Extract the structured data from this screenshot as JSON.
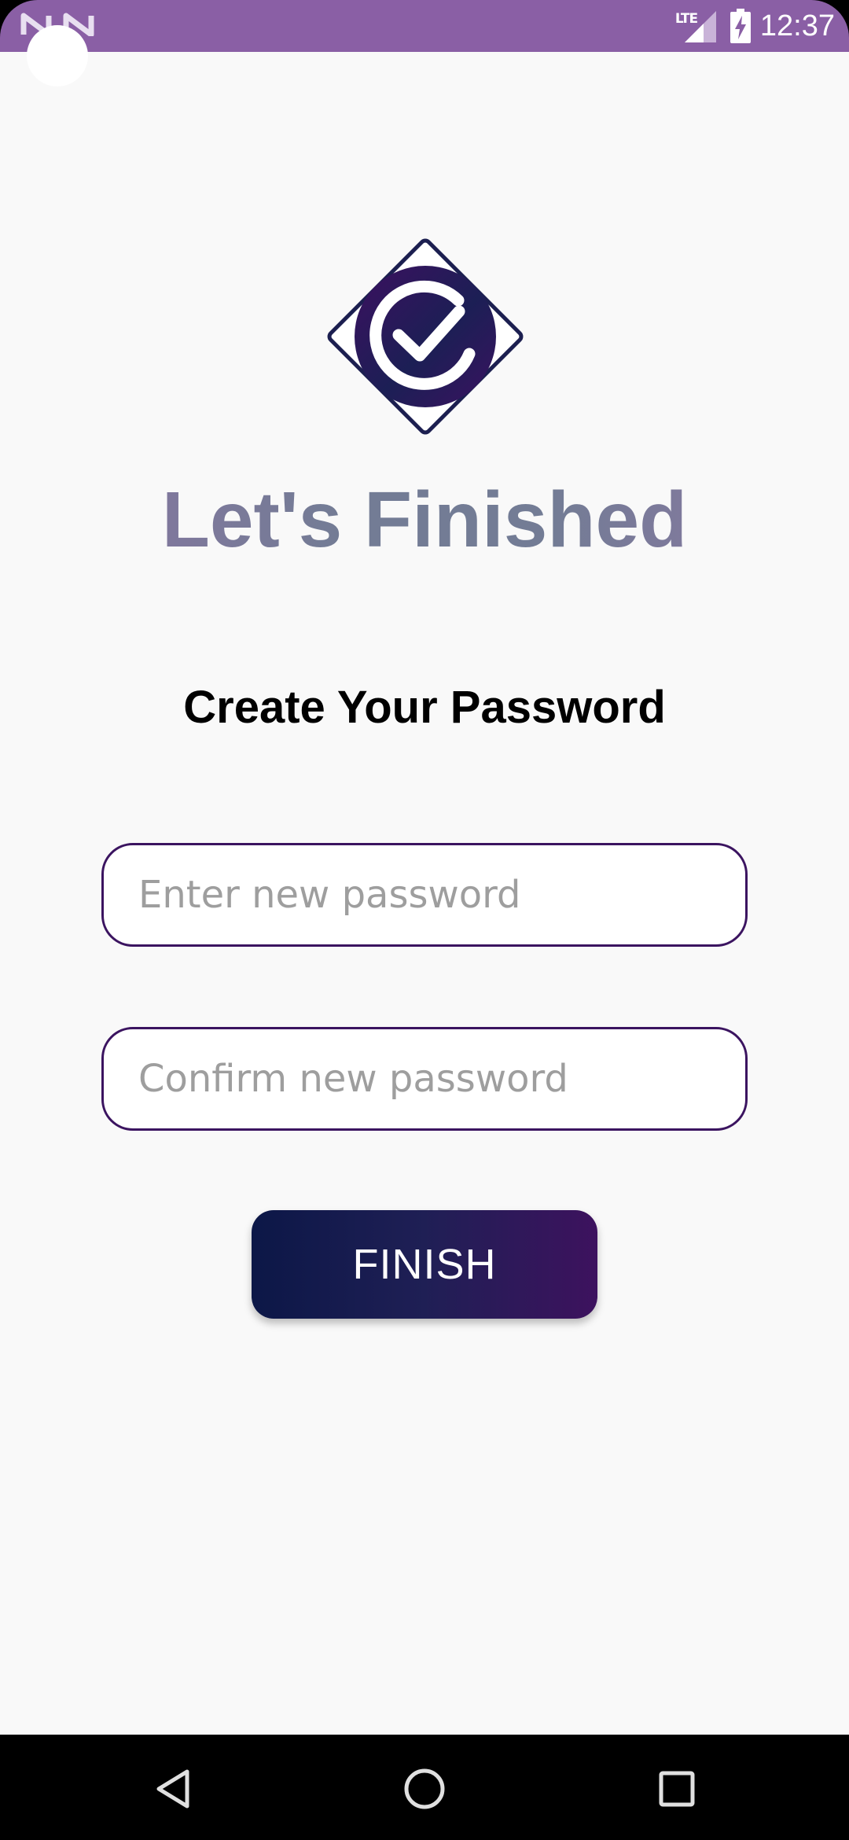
{
  "status_bar": {
    "network": "LTE",
    "time": "12:37",
    "notification_icons": [
      "n-notification-icon",
      "n-notification-icon"
    ],
    "battery_icon": "battery-charging-icon",
    "signal_icon": "signal-icon",
    "background_color": "#8a5fa5"
  },
  "app": {
    "logo_icon": "check-circle-diamond-logo",
    "title": "Let's Finished",
    "heading": "Create Your Password",
    "new_password": {
      "value": "",
      "placeholder": "Enter new password"
    },
    "confirm_password": {
      "value": "",
      "placeholder": "Confirm new password"
    },
    "finish_label": "FINISH",
    "colors": {
      "accent": "#3b1460",
      "button_start": "#0c1747",
      "button_end": "#3d125e"
    }
  },
  "nav_bar": {
    "back_icon": "back-triangle-icon",
    "home_icon": "home-circle-icon",
    "recents_icon": "recents-square-icon"
  }
}
